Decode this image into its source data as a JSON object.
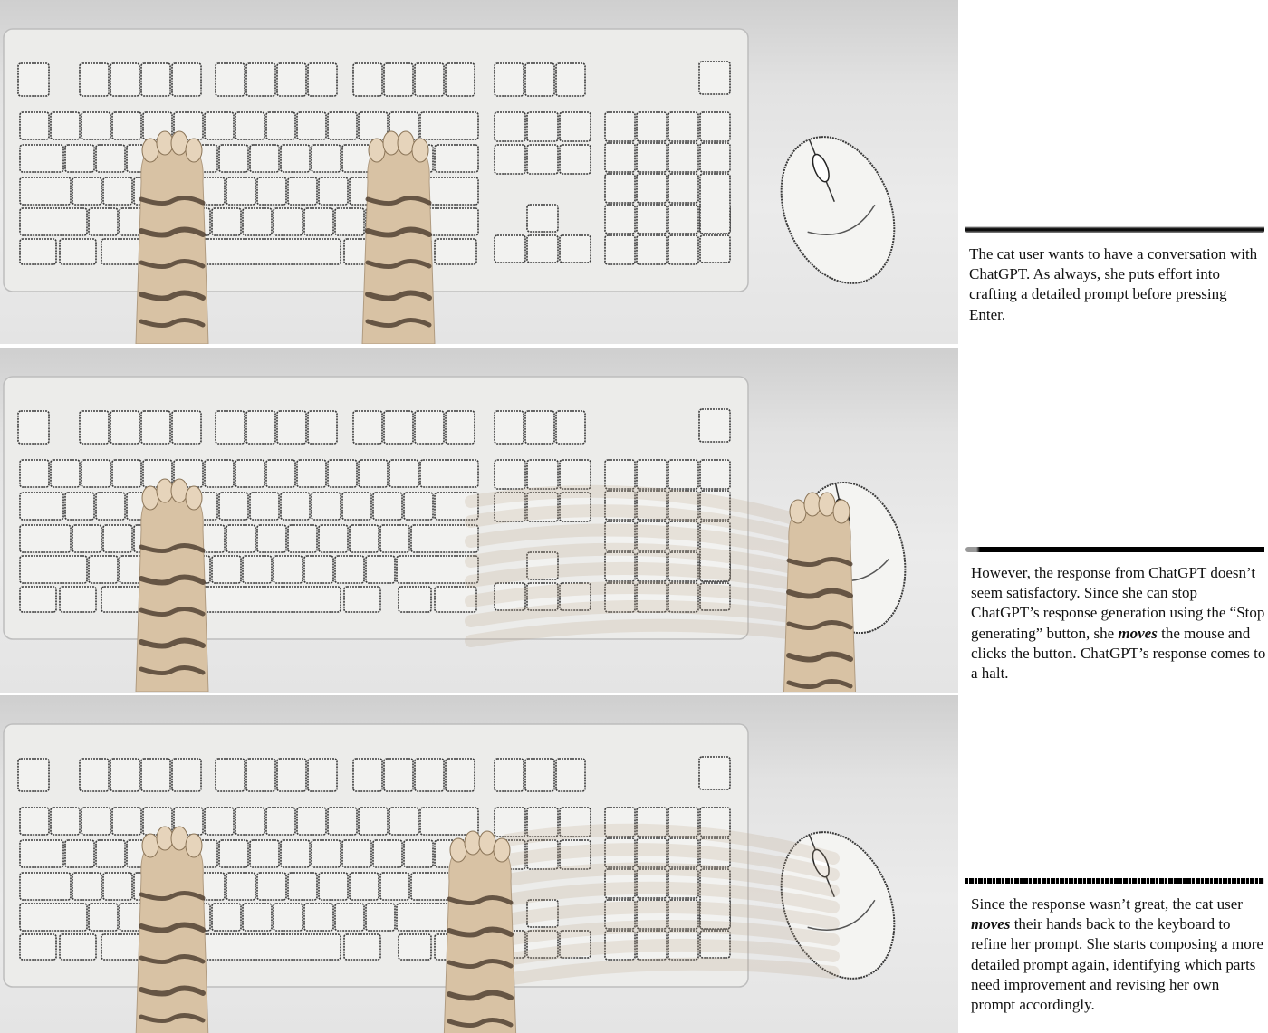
{
  "panels": [
    {
      "caption_parts": [
        {
          "text": "The cat user wants to have a conversation with ChatGPT. As always, she puts effort into crafting a detailed prompt before pressing Enter.",
          "emphasis": false
        }
      ]
    },
    {
      "caption_parts": [
        {
          "text": "However, the response from ChatGPT doesn’t seem satisfactory. Since she can stop ChatGPT’s response generation using the “Stop generating” button, she ",
          "emphasis": false
        },
        {
          "text": "moves",
          "emphasis": true
        },
        {
          "text": " the mouse and clicks the button. ChatGPT’s response comes to a halt.",
          "emphasis": false
        }
      ]
    },
    {
      "caption_parts": [
        {
          "text": "Since the response wasn’t great, the cat user ",
          "emphasis": false
        },
        {
          "text": "moves",
          "emphasis": true
        },
        {
          "text": " their hands back to the keyboard to refine her prompt. She starts composing a more detailed prompt again, identifying which parts need improvement and revising her own prompt accordingly.",
          "emphasis": false
        }
      ]
    }
  ],
  "colors": {
    "background": "#e6e6e6",
    "keyboard": "#ececea",
    "key": "#f2f2f0",
    "key_outline": "#3a3a3a",
    "fur": "#d8c2a4",
    "stripe": "#4a3a2c",
    "text": "#111111"
  }
}
